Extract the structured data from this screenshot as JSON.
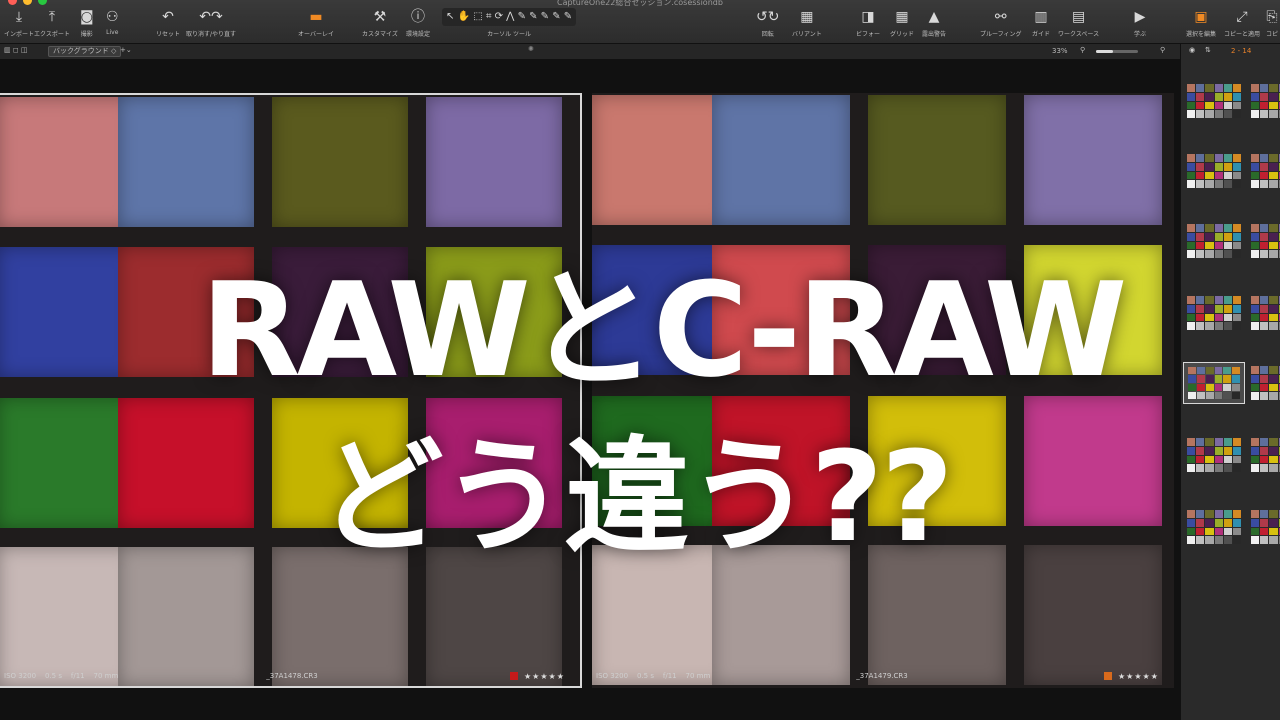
{
  "window": {
    "title": "CaptureOne22総合セッション.cosessiondb",
    "traffic_lights": [
      "#ff5f57",
      "#febc2e",
      "#28c840"
    ]
  },
  "toolbar": {
    "left_buttons": [
      {
        "icon": "download-arrow-icon",
        "glyph": "⤓",
        "label": "インポート"
      },
      {
        "icon": "upload-arrow-icon",
        "glyph": "⤒",
        "label": "エクスポート"
      },
      {
        "icon": "camera-icon",
        "glyph": "◙",
        "label": "撮影"
      },
      {
        "icon": "tether-live-icon",
        "glyph": "⚇",
        "label": "Live"
      },
      {
        "icon": "reset-icon",
        "glyph": "↶",
        "label": "リセット"
      },
      {
        "icon": "undo-redo-icon",
        "glyph": "↶↷",
        "label": "取り消す/やり直す"
      }
    ],
    "center_buttons": [
      {
        "icon": "overlay-icon",
        "glyph": "▬",
        "label": "オーバーレイ",
        "accent": true
      },
      {
        "icon": "customize-tools-icon",
        "glyph": "⚒",
        "label": "カスタマイズ"
      },
      {
        "icon": "preferences-icon",
        "glyph": "ⓘ",
        "label": "環境設定"
      },
      {
        "icon": "cursor-tools-icon",
        "glyph": "↖ ✋ ⬚ ⌗ ⟳ ⋀ ✎ ✎ ✎ ✎ ✎",
        "label": "カーソル ツール"
      }
    ],
    "right_buttons": [
      {
        "icon": "rotate-icon",
        "glyph": "↺↻",
        "label": "回転"
      },
      {
        "icon": "variant-icon",
        "glyph": "▦",
        "label": "バリアント"
      },
      {
        "icon": "before-after-icon",
        "glyph": "◨",
        "label": "ビフォー"
      },
      {
        "icon": "grid-icon",
        "glyph": "▦",
        "label": "グリッド"
      },
      {
        "icon": "exposure-warning-icon",
        "glyph": "▲",
        "label": "露出警告"
      },
      {
        "icon": "proofing-icon",
        "glyph": "⚯",
        "label": "プルーフィング"
      },
      {
        "icon": "guide-icon",
        "glyph": "▥",
        "label": "ガイド"
      },
      {
        "icon": "workspace-icon",
        "glyph": "▤",
        "label": "ワークスペース"
      },
      {
        "icon": "learn-icon",
        "glyph": "▶",
        "label": "学ぶ"
      },
      {
        "icon": "edit-selection-icon",
        "glyph": "▣",
        "label": "選択を編集",
        "accent": true
      },
      {
        "icon": "copy-apply-icon",
        "glyph": "⤢",
        "label": "コピーと適用"
      },
      {
        "icon": "copy-icon",
        "glyph": "⎘",
        "label": "コピ"
      }
    ]
  },
  "subbar": {
    "background_select": "バックグラウンド",
    "zoom": "33%",
    "zoom_fraction": 0.4
  },
  "browser": {
    "count": "2 - 14"
  },
  "images": [
    {
      "iso": "ISO 3200",
      "shutter": "0.5 s",
      "aperture": "f/11",
      "focal": "70 mm",
      "filename": "_37A1478.CR3",
      "color_tag": "#c41a1a",
      "stars": "★★★★★"
    },
    {
      "iso": "ISO 3200",
      "shutter": "0.5 s",
      "aperture": "f/11",
      "focal": "70 mm",
      "filename": "_37A1479.CR3",
      "color_tag": "#d86a1c",
      "stars": "★★★★★"
    }
  ],
  "overlay": {
    "line1": "RAWとC-RAW",
    "line2": "どう違う??"
  },
  "patch_colors": {
    "left": [
      [
        "#c7797a",
        "#5e75a8",
        "#5a5a1e",
        "#7d6aa5"
      ],
      [
        "#3140a0",
        "#9c2c2e",
        "#3a1c3a",
        "#8b9c1a"
      ],
      [
        "#2a7a2a",
        "#c6102a",
        "#c4b400",
        "#a81e6e"
      ],
      [
        "#c7b8b6",
        "#a39896",
        "#7a6e6c",
        "#4e4645"
      ]
    ],
    "right": [
      [
        "#c9786e",
        "#5f74a6",
        "#565a20",
        "#8070a8"
      ],
      [
        "#2d3a96",
        "#d04a4e",
        "#3a1c36",
        "#d2d630"
      ],
      [
        "#1f6a1f",
        "#c01428",
        "#d2be0a",
        "#c13a8c"
      ],
      [
        "#c8b6b2",
        "#a89a98",
        "#6e6260",
        "#4a4040"
      ]
    ]
  },
  "thumb_colors": [
    "#b57560",
    "#5f6f9c",
    "#6a6a2a",
    "#7c6aa2",
    "#4a9c8c",
    "#d48a24",
    "#3a4ca0",
    "#b03a4a",
    "#4a2050",
    "#9aae2a",
    "#d0a010",
    "#3090b0",
    "#2a6a2a",
    "#c02030",
    "#d8c010",
    "#b0307a",
    "#d0d0d0",
    "#8a8a8a",
    "#f0f0f0",
    "#c0c0c0",
    "#a8a8a8",
    "#7a7a7a",
    "#505050",
    "#282828"
  ]
}
